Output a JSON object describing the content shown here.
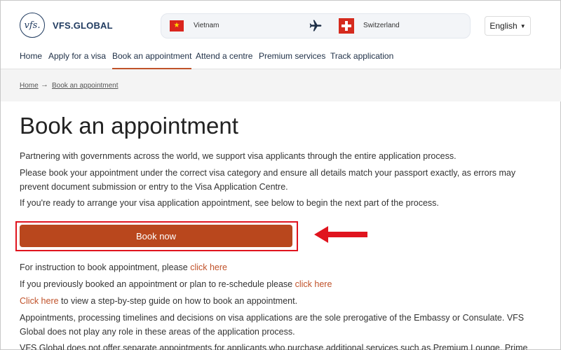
{
  "header": {
    "logo_mark": "vfs.",
    "logo_text": "VFS.GLOBAL",
    "from_country": "Vietnam",
    "to_country": "Switzerland",
    "language": "English"
  },
  "nav": {
    "items": [
      {
        "label": "Home"
      },
      {
        "label": "Apply for a visa"
      },
      {
        "label": "Book an appointment"
      },
      {
        "label": "Attend a centre"
      },
      {
        "label": "Premium services"
      },
      {
        "label": "Track application"
      }
    ],
    "active_index": 2
  },
  "breadcrumb": {
    "items": [
      "Home",
      "Book an appointment"
    ],
    "separator": "→"
  },
  "main": {
    "title": "Book an appointment",
    "intro": [
      "Partnering with governments across the world, we support visa applicants through the entire application process.",
      "Please book your appointment under the correct visa category and ensure all details match your passport exactly, as errors may prevent document submission or entry to the Visa Application Centre.",
      "If you're ready to arrange your visa application appointment, see below to begin the next part of the process."
    ],
    "book_button": "Book now",
    "instruction_text": "For instruction to book appointment, please ",
    "instruction_link": "click here",
    "reschedule_text": "If you previously booked an appointment or plan to re-schedule please ",
    "reschedule_link": "click here",
    "guide_link": "Click here",
    "guide_text": " to view a step-by-step guide on how to book an appointment.",
    "disclaimer": "Appointments, processing timelines and decisions on visa applications are the sole prerogative of the Embassy or Consulate. VFS Global does not play any role in these areas of the application process.",
    "premium_note": "VFS Global does not offer separate appointments for applicants who purchase additional services such as Premium Lounge, Prime"
  },
  "colors": {
    "accent": "#b9471d",
    "link": "#c0522a",
    "highlight": "#e0141e",
    "brand": "#1f3a5f"
  },
  "icons": {
    "plane": "plane-icon",
    "arrow": "red-arrow-left-icon"
  }
}
